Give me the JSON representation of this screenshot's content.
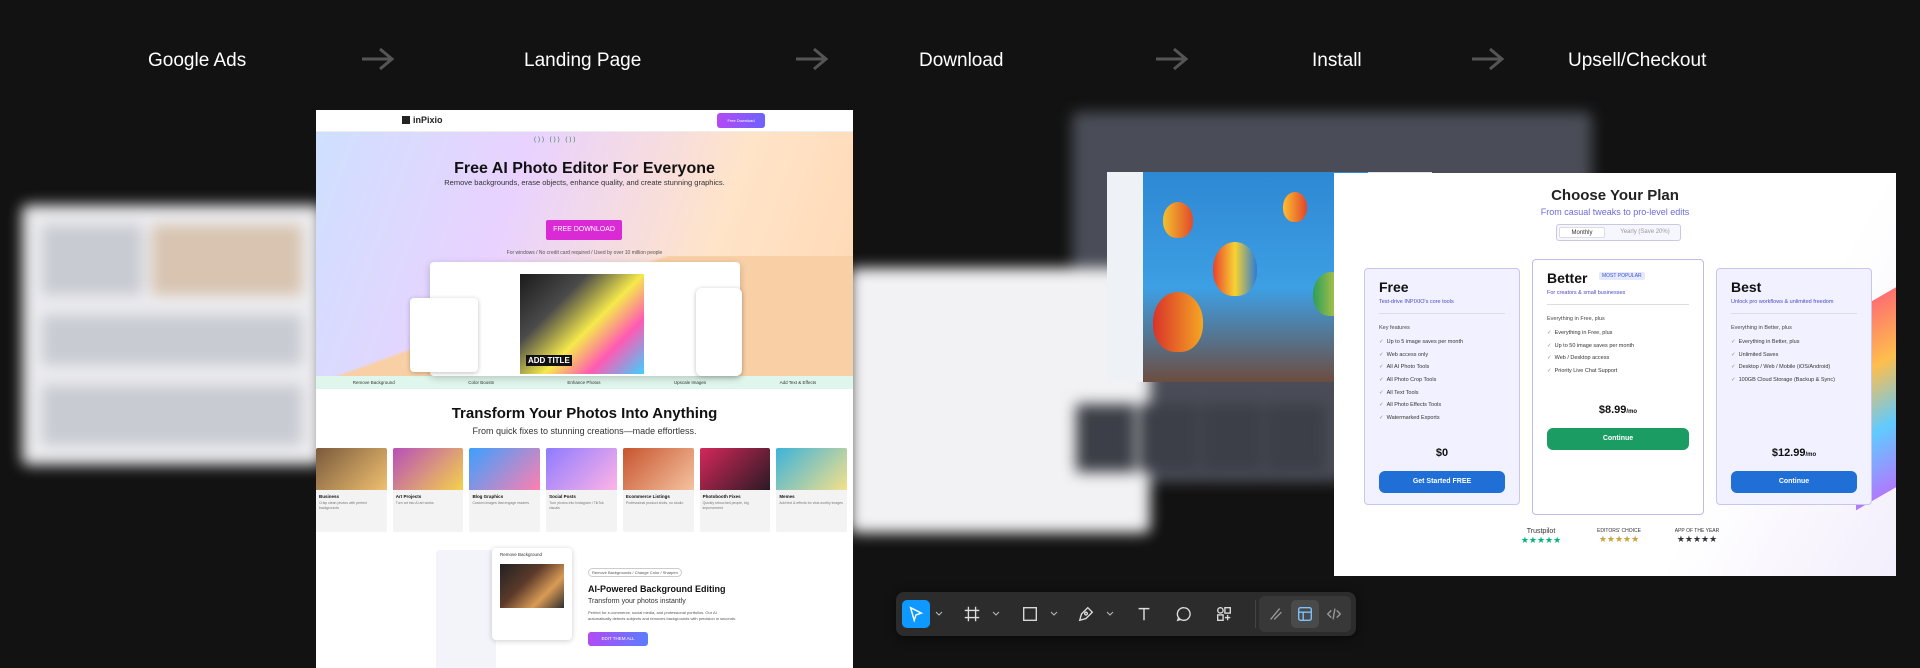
{
  "steps": [
    "Google Ads",
    "Landing Page",
    "Download",
    "Install",
    "Upsell/Checkout"
  ],
  "landing": {
    "logo": "inPixio",
    "nav_button": "Free Download",
    "badges": "())  ())  ())",
    "headline": "Free AI Photo Editor For Everyone",
    "subheadline": "Remove backgrounds, erase objects, enhance quality, and create stunning graphics.",
    "download_button": "FREE DOWNLOAD",
    "fine_print": "For windows / No credit card required / Used by over 10 million people",
    "art_text": "ADD TITLE",
    "features": [
      "Remove Background",
      "Color Boosts",
      "Enhance Photos",
      "Upscale Images",
      "Add Text & Effects"
    ],
    "transform_title": "Transform Your Photos Into Anything",
    "transform_sub": "From quick fixes to stunning creations—made effortless.",
    "cards": [
      {
        "title": "Business",
        "desc": "Crisp clean photos with perfect backgrounds",
        "c1": "#7a5a3c",
        "c2": "#f0c070"
      },
      {
        "title": "Art Projects",
        "desc": "Turn art into AI art works",
        "c1": "#b84fb8",
        "c2": "#f5d24b"
      },
      {
        "title": "Blog Graphics",
        "desc": "Custom images that engage readers",
        "c1": "#3aa0ff",
        "c2": "#ff7fb0"
      },
      {
        "title": "Social Posts",
        "desc": "Turn photos into Instagram / TikTok visuals",
        "c1": "#8e7bff",
        "c2": "#ffb3e6"
      },
      {
        "title": "Ecommerce Listings",
        "desc": "Professional product shots, no studio",
        "c1": "#c7542f",
        "c2": "#f5c3a0"
      },
      {
        "title": "Photobooth Fixes",
        "desc": "Quickly retouched people, big improvement",
        "c1": "#d4285a",
        "c2": "#2a1a24"
      },
      {
        "title": "Memes",
        "desc": "Add text & effects for viral-worthy images",
        "c1": "#3cb3d9",
        "c2": "#f5e08a"
      }
    ],
    "bg_panel_title": "Remove Background",
    "bg_tag": "Remove Backgrounds / Change Color / Sharpen",
    "bg_heading": "AI-Powered Background Editing",
    "bg_sub": "Transform your photos instantly",
    "bg_desc": "Perfect for e-commerce, social media, and professional portfolios. Our AI automatically detects subjects and removes backgrounds with precision in seconds.",
    "bg_button": "EDIT THEM ALL"
  },
  "pricing": {
    "title": "Choose Your Plan",
    "subtitle": "From casual tweaks to pro-level edits",
    "toggle_monthly": "Monthly",
    "toggle_yearly": "Yearly (Save 20%)",
    "plans": [
      {
        "name": "Free",
        "desc": "Test-drive INPIXIO's core tools",
        "intro": "Key features",
        "features": [
          "Up to 5 image saves per month",
          "Web access only",
          "All AI Photo Tools",
          "All Photo Crop Tools",
          "All Text Tools",
          "All Photo Effects Tools",
          "Watermarked Exports"
        ],
        "price": "$0",
        "price_unit": "",
        "button": "Get Started FREE",
        "button_color": "#1f6fd6"
      },
      {
        "name": "Better",
        "badge": "MOST POPULAR",
        "desc": "For creators & small businesses",
        "intro": "Everything in Free, plus",
        "features": [
          "Everything in Free, plus",
          "Up to 50 image saves per month",
          "Web / Desktop access",
          "Priority Live Chat Support"
        ],
        "price": "$8.99",
        "price_unit": "/mo",
        "button": "Continue",
        "button_color": "#1a9c62"
      },
      {
        "name": "Best",
        "desc": "Unlock pro workflows & unlimited freedom",
        "intro": "Everything in Better, plus",
        "features": [
          "Everything in Better, plus",
          "Unlimited Saves",
          "Desktop / Web / Mobile (iOS/Android)",
          "100GB Cloud Storage (Backup & Sync)"
        ],
        "price": "$12.99",
        "price_unit": "/mo",
        "button": "Continue",
        "button_color": "#1f6fd6"
      }
    ],
    "trust": [
      "Trustpilot",
      "EDITORS' CHOICE",
      "APP OF THE YEAR"
    ]
  },
  "toolbar": {
    "tools": [
      "move-tool",
      "frame-tool",
      "shape-tool",
      "pen-tool",
      "text-tool",
      "comment-tool",
      "actions-tool"
    ],
    "dev": [
      "draw-mode",
      "design-mode",
      "dev-mode"
    ],
    "accent": "#0d99ff"
  }
}
